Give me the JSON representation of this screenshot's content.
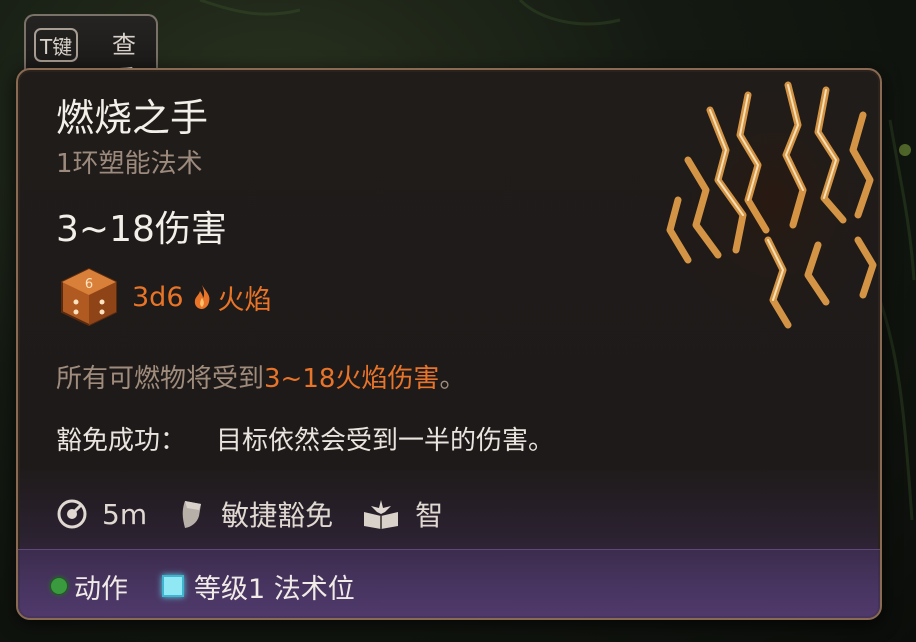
{
  "tab": {
    "key": "T键",
    "label": "查看"
  },
  "spell": {
    "title": "燃烧之手",
    "subtitle": "1环塑能法术",
    "damage": "3~18伤害",
    "dice": "3d6",
    "damage_type": "火焰",
    "description_prefix": "所有可燃物将受到",
    "description_highlight": "3~18火焰伤害",
    "description_suffix": "。",
    "save_label": "豁免成功：",
    "save_text": "目标依然会受到一半的伤害。"
  },
  "stats": {
    "range": "5m",
    "save_type": "敏捷豁免",
    "ability": "智"
  },
  "footer": {
    "action": "动作",
    "slot": "等级1 法术位"
  },
  "icons": {
    "dice": "d6-dice-icon",
    "flame": "flame-icon",
    "range": "range-icon",
    "save": "shield-icon",
    "ability": "spellbook-icon",
    "action": "action-dot-icon",
    "slot": "spell-slot-icon"
  },
  "colors": {
    "accent_orange": "#e8742a",
    "muted_text": "#9c8a7d",
    "title_text": "#f2eee8",
    "border": "#8a6a52",
    "action_green": "#3a9a3e",
    "slot_cyan": "#8fe8f4"
  }
}
